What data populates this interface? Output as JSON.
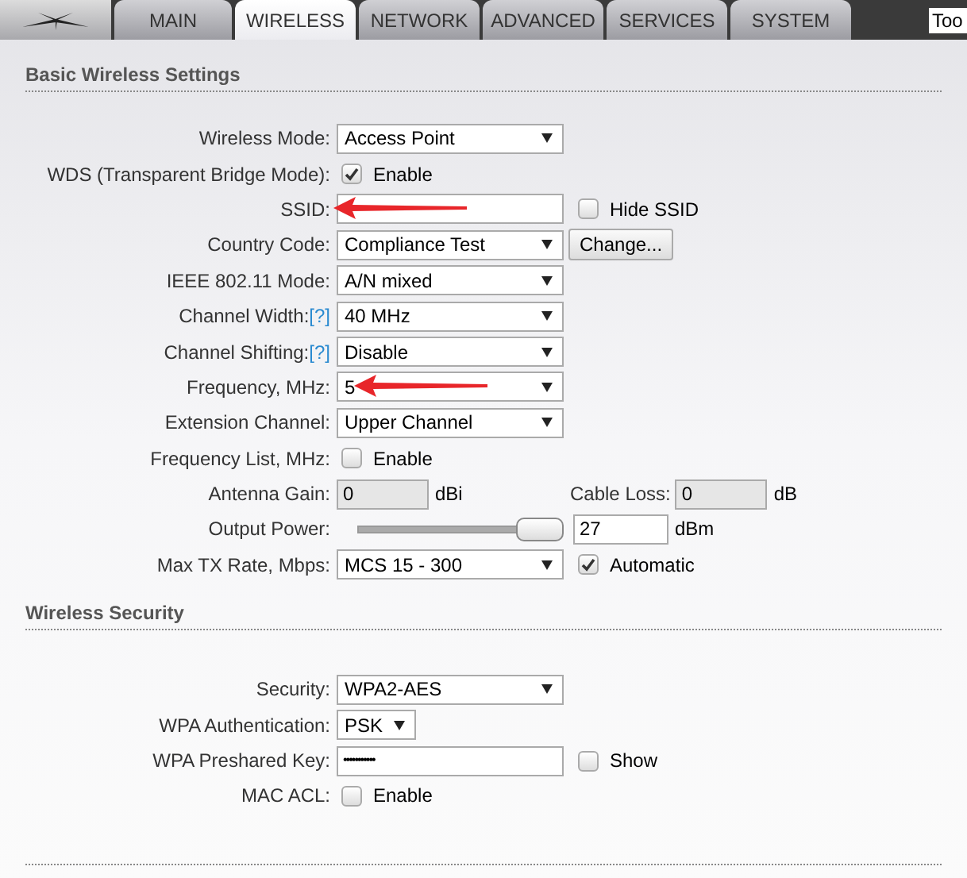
{
  "tabs": [
    {
      "label": "MAIN",
      "selected": false
    },
    {
      "label": "WIRELESS",
      "selected": true
    },
    {
      "label": "NETWORK",
      "selected": false
    },
    {
      "label": "ADVANCED",
      "selected": false
    },
    {
      "label": "SERVICES",
      "selected": false
    },
    {
      "label": "SYSTEM",
      "selected": false
    }
  ],
  "tools": {
    "value": "Too"
  },
  "sections": [
    {
      "title": "Basic Wireless Settings",
      "rows": [
        {
          "kind": "select",
          "label": "Wireless Mode:",
          "value": "Access Point"
        },
        {
          "kind": "checkbox",
          "label": "WDS (Transparent Bridge Mode):",
          "checked": true,
          "text": "Enable"
        },
        {
          "kind": "text",
          "label": "SSID:",
          "annotated": true,
          "extra": {
            "kind": "checkbox",
            "checked": false,
            "text": "Hide SSID"
          }
        },
        {
          "kind": "select",
          "label": "Country Code:",
          "value": "Compliance Test",
          "extra": {
            "kind": "button",
            "text": "Change..."
          }
        },
        {
          "kind": "select",
          "label": "IEEE 802.11 Mode:",
          "value": "A/N mixed"
        },
        {
          "kind": "select",
          "label": "Channel Width:",
          "help": "[?]",
          "value": "40 MHz"
        },
        {
          "kind": "select",
          "label": "Channel Shifting:",
          "help": "[?]",
          "value": "Disable"
        },
        {
          "kind": "select",
          "label": "Frequency, MHz:",
          "value": "5",
          "annotated": true
        },
        {
          "kind": "select",
          "label": "Extension Channel:",
          "value": "Upper Channel"
        },
        {
          "kind": "checkbox",
          "label": "Frequency List, MHz:",
          "checked": false,
          "text": "Enable"
        },
        {
          "kind": "gain",
          "label": "Antenna Gain:",
          "value": "0",
          "unit": "dBi",
          "label2": "Cable Loss:",
          "value2": "0",
          "unit2": "dB"
        },
        {
          "kind": "slider",
          "label": "Output Power:",
          "level": 1,
          "value": "27",
          "unit": "dBm"
        },
        {
          "kind": "select",
          "label": "Max TX Rate, Mbps:",
          "value": "MCS 15 - 300",
          "extra": {
            "kind": "checkbox",
            "checked": true,
            "text": "Automatic"
          }
        }
      ]
    },
    {
      "title": "Wireless Security",
      "rows": [
        {
          "kind": "select",
          "label": "Security:",
          "value": "WPA2-AES"
        },
        {
          "kind": "smallselect",
          "label": "WPA Authentication:",
          "value": "PSK"
        },
        {
          "kind": "text",
          "label": "WPA Preshared Key:",
          "value": "•••••••••••",
          "extra": {
            "kind": "checkbox",
            "checked": false,
            "text": "Show"
          }
        },
        {
          "kind": "checkbox",
          "label": "MAC ACL:",
          "checked": false,
          "text": "Enable"
        }
      ]
    }
  ]
}
